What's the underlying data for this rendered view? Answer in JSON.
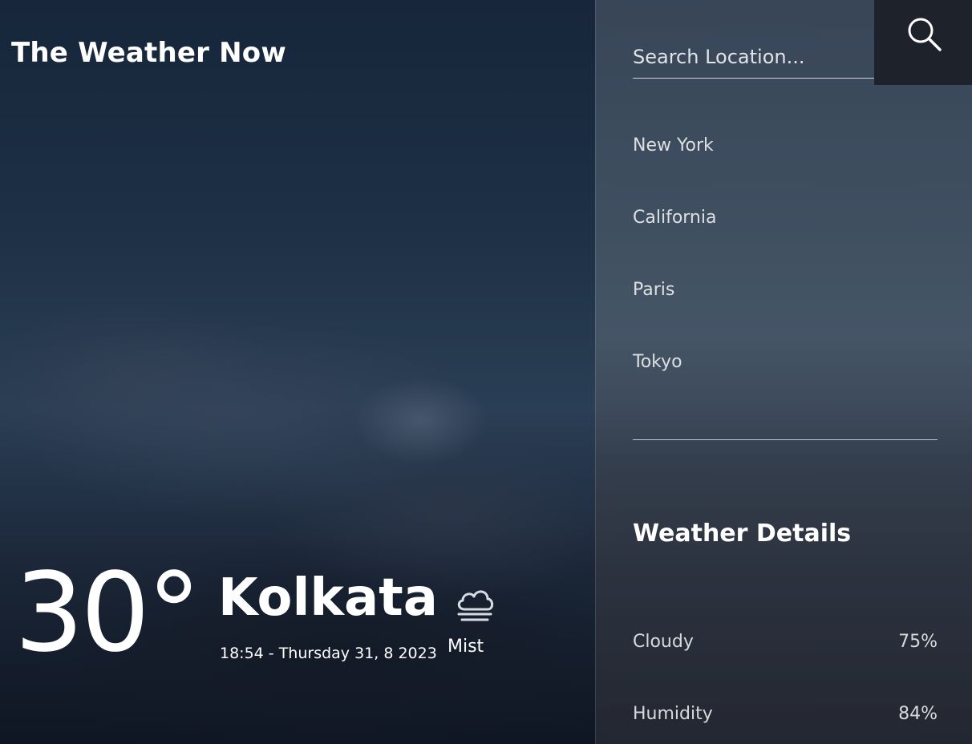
{
  "brand": {
    "title": "The Weather Now"
  },
  "current": {
    "temperature": "30°",
    "city": "Kolkata",
    "datetime": "18:54 - Thursday 31, 8 2023",
    "condition": "Mist",
    "condition_icon": "cloud-mist-icon"
  },
  "search": {
    "placeholder": "Search Location...",
    "value": "",
    "button_icon": "search-icon"
  },
  "locations": [
    {
      "label": "New York"
    },
    {
      "label": "California"
    },
    {
      "label": "Paris"
    },
    {
      "label": "Tokyo"
    }
  ],
  "details": {
    "title": "Weather Details",
    "rows": [
      {
        "label": "Cloudy",
        "value": "75%"
      },
      {
        "label": "Humidity",
        "value": "84%"
      }
    ]
  },
  "colors": {
    "panel_bg": "#5a6878",
    "search_button_bg": "#1d222b",
    "text": "#ffffff"
  }
}
